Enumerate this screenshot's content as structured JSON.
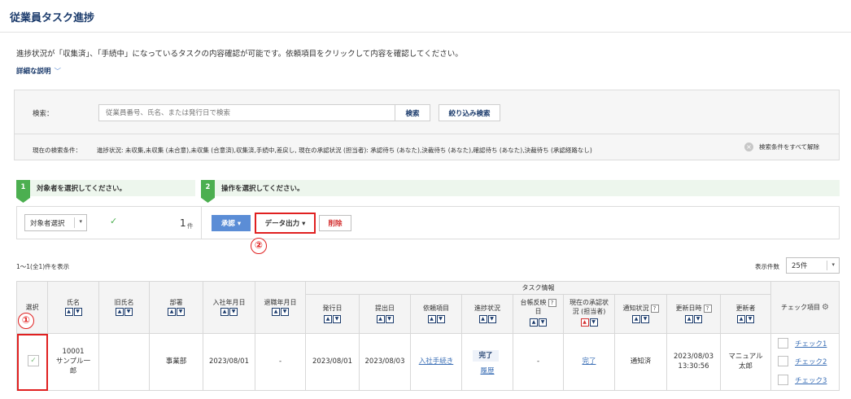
{
  "header": {
    "title": "従業員タスク進捗"
  },
  "intro": {
    "description": "進捗状況が「収集済」、「手続中」になっているタスクの内容確認が可能です。依頼項目をクリックして内容を確認してください。",
    "detail_link": "詳細な説明",
    "chevron_icon": "chevron-down-icon"
  },
  "search": {
    "label": "検索：",
    "placeholder": "従業員番号、氏名、または発行日で検索",
    "search_button": "検索",
    "filter_button": "絞り込み検索",
    "condition_label": "現在の検索条件：",
    "condition_text": "進捗状況: 未収集,未収集 (未合意),未収集 (合意済),収集済,手続中,差戻し, 現在の承認状況 (担当者): 承認待ち (あなた),決裁待ち (あなた),確認待ち (あなた),決裁待ち (承認経路なし)",
    "clear_label": "検索条件をすべて解除",
    "clear_icon": "close-circle-icon"
  },
  "steps": [
    {
      "number": "1",
      "label": "対象者を選択してください。"
    },
    {
      "number": "2",
      "label": "操作を選択してください。"
    }
  ],
  "actions": {
    "select_target": "対象者選択",
    "check_icon": "check-icon",
    "count": "1",
    "count_unit": "件",
    "approve": "承認 ▾",
    "export": "データ出力 ▾",
    "delete": "削除"
  },
  "markers": {
    "one": "①",
    "two": "②"
  },
  "list": {
    "range": "1～1(全1)件を表示",
    "per_page_label": "表示件数",
    "per_page_value": "25件",
    "caret": "▾"
  },
  "table": {
    "headers": {
      "select": "選択",
      "name": "氏名",
      "old_name": "旧氏名",
      "dept": "部署",
      "join_date": "入社年月日",
      "leave_date": "退職年月日",
      "task_group": "タスク情報",
      "issue_date": "発行日",
      "submit_date": "提出日",
      "request_item": "依頼項目",
      "progress": "進捗状況",
      "ledger_1": "台帳反映",
      "ledger_2": "日",
      "approval_1": "現在の承認状",
      "approval_2": "況 (担当者)",
      "notice": "通知状況",
      "updated_at": "更新日時",
      "updater": "更新者",
      "check_items": "チェック項目"
    },
    "sort_up": "▲",
    "sort_down": "▼",
    "help": "?",
    "gear_icon": "gear-icon",
    "row": {
      "emp_no": "10001",
      "name_1": "サンプル一",
      "name_2": "郎",
      "old_name": "",
      "dept": "事業部",
      "join_date": "2023/08/01",
      "leave_date": "-",
      "issue_date": "2023/08/01",
      "submit_date": "2023/08/03",
      "request_item": "入社手続き",
      "progress": "完了",
      "history": "履歴",
      "ledger": "-",
      "approval": "完了",
      "notice": "通知済",
      "updated_date": "2023/08/03",
      "updated_time": "13:30:56",
      "updater_1": "マニュアル",
      "updater_2": "太郎",
      "check_mark": "✓",
      "checks": [
        "チェック1",
        "チェック2",
        "チェック3"
      ]
    }
  }
}
